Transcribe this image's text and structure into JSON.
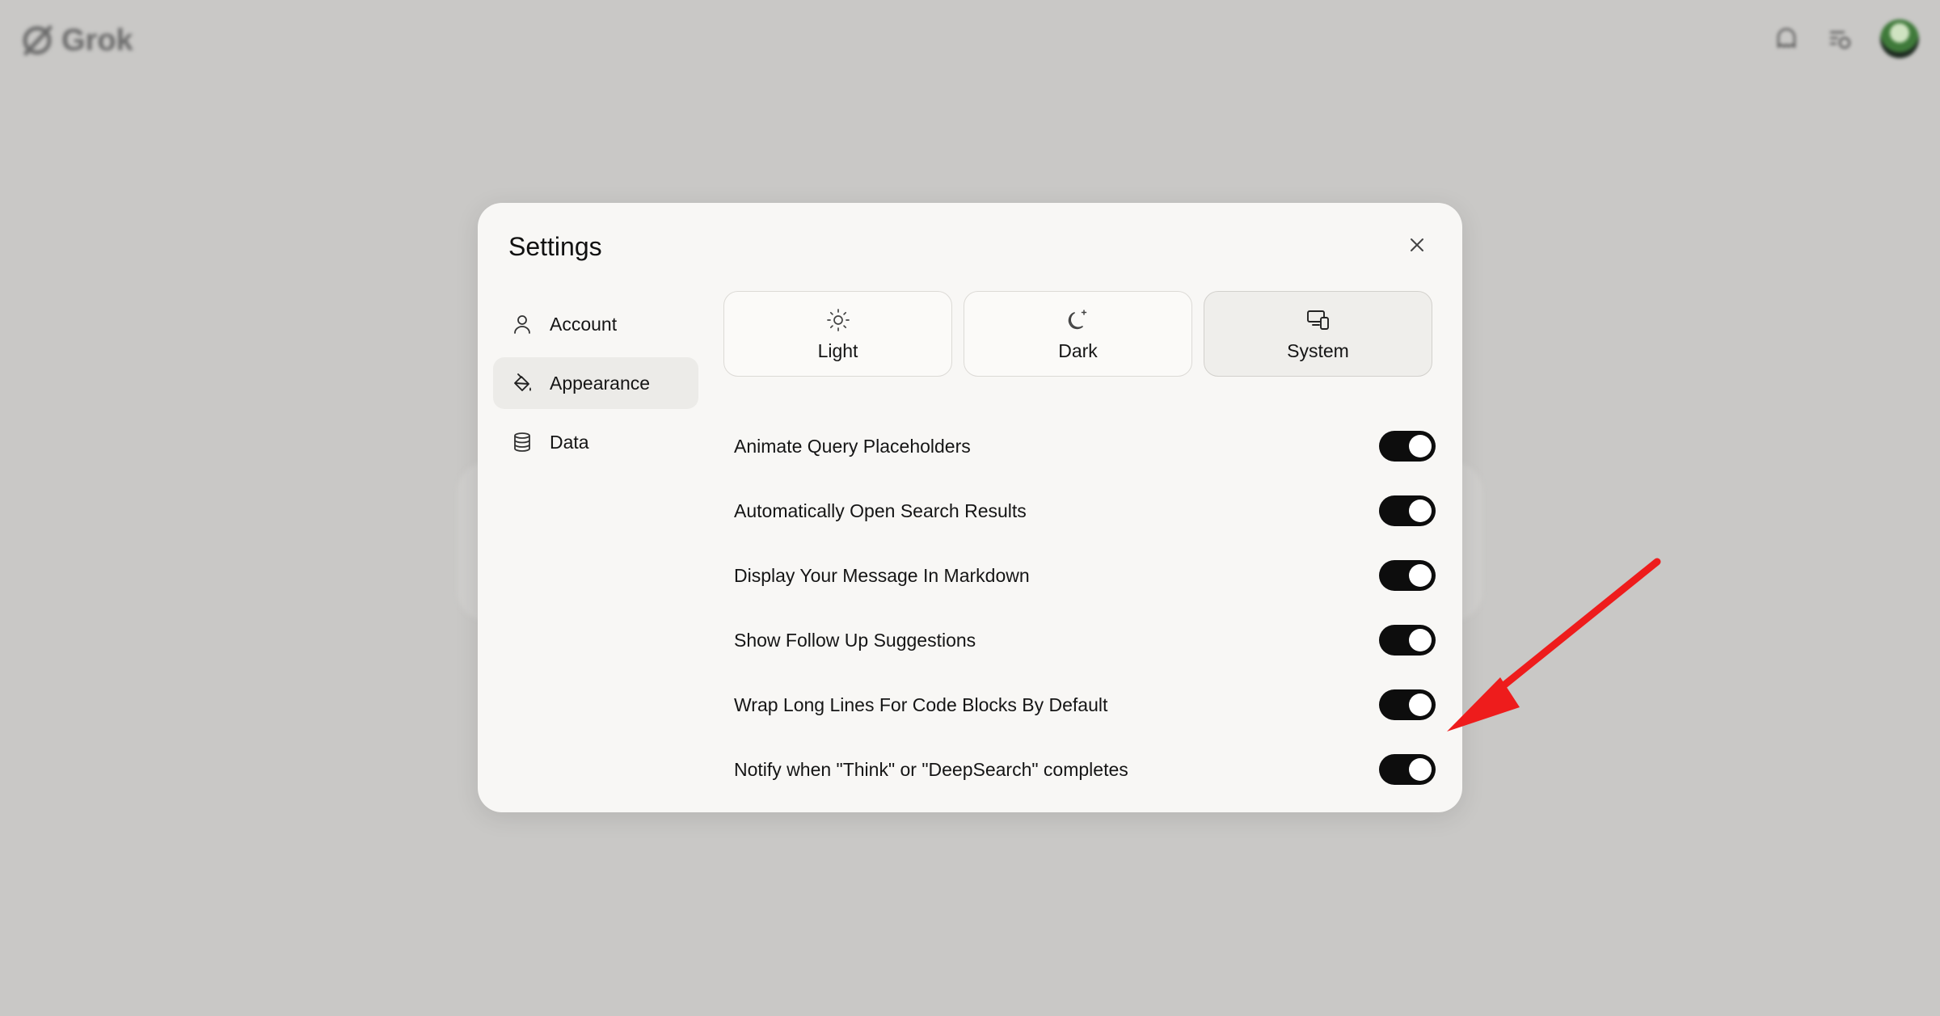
{
  "app": {
    "name": "Grok"
  },
  "modal": {
    "title": "Settings"
  },
  "sidebar": {
    "items": [
      {
        "label": "Account",
        "icon": "user-icon"
      },
      {
        "label": "Appearance",
        "icon": "paint-bucket-icon",
        "active": true
      },
      {
        "label": "Data",
        "icon": "database-icon"
      }
    ]
  },
  "themes": [
    {
      "label": "Light",
      "icon": "sun-icon"
    },
    {
      "label": "Dark",
      "icon": "moon-icon"
    },
    {
      "label": "System",
      "icon": "devices-icon",
      "active": true
    }
  ],
  "settings": [
    {
      "label": "Animate Query Placeholders",
      "enabled": true
    },
    {
      "label": "Automatically Open Search Results",
      "enabled": true
    },
    {
      "label": "Display Your Message In Markdown",
      "enabled": true
    },
    {
      "label": "Show Follow Up Suggestions",
      "enabled": true
    },
    {
      "label": "Wrap Long Lines For Code Blocks By Default",
      "enabled": true
    },
    {
      "label": "Notify when \"Think\" or \"DeepSearch\" completes",
      "enabled": true
    }
  ],
  "colors": {
    "backdrop": "#c9c8c6",
    "modal": "#f8f7f5",
    "toggle_on": "#0d0d0d",
    "annotation_arrow": "#ee1c1c"
  }
}
